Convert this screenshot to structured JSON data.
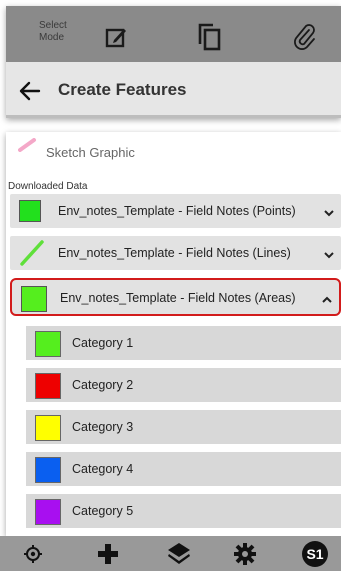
{
  "toolbar": {
    "select_mode_label": "Select Mode",
    "icons": [
      "edit-icon",
      "copy-icon",
      "attachment-icon"
    ]
  },
  "header": {
    "back_icon": "back-arrow-icon",
    "title": "Create Features"
  },
  "panel": {
    "sketch_label": "Sketch Graphic",
    "section_label": "Downloaded Data",
    "templates": [
      {
        "label": "Env_notes_Template - Field Notes (Points)",
        "icon": "green-square",
        "color": "#22e01d",
        "state": "collapsed"
      },
      {
        "label": "Env_notes_Template - Field Notes (Lines)",
        "icon": "green-line",
        "color": "#5fe03a",
        "state": "collapsed"
      },
      {
        "label": "Env_notes_Template - Field Notes (Areas)",
        "icon": "green-square",
        "color": "#55ee1e",
        "state": "expanded"
      }
    ],
    "categories": [
      {
        "label": "Category 1",
        "color": "#55ee1e"
      },
      {
        "label": "Category 2",
        "color": "#ee0000"
      },
      {
        "label": "Category 3",
        "color": "#ffff00"
      },
      {
        "label": "Category 4",
        "color": "#0a5ff0"
      },
      {
        "label": "Category 5",
        "color": "#a80ff0"
      }
    ]
  },
  "bottombar": {
    "icons": [
      "target-icon",
      "add-icon",
      "layers-icon",
      "settings-icon",
      "s1-logo-icon"
    ]
  },
  "colors": {
    "selection_outline": "#d21b1b",
    "toolbar_bg": "#8a8a8a",
    "bottombar_bg": "#999999"
  }
}
